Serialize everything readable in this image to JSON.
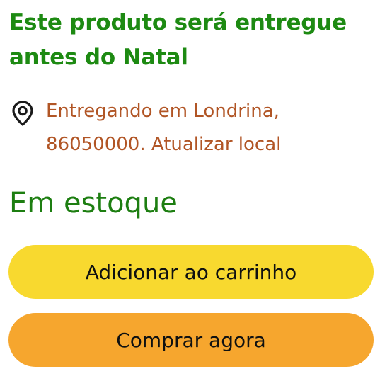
{
  "delivery": {
    "headline": "Este produto será entregue antes do Natal"
  },
  "location": {
    "icon": "location-pin-icon",
    "text": "Entregando em Londrina, 86050000. Atualizar local",
    "color": "#b15525"
  },
  "stock": {
    "status": "Em estoque",
    "color": "#1d7e11"
  },
  "actions": {
    "add_to_cart_label": "Adicionar ao carrinho",
    "add_to_cart_color": "#f8d92f",
    "buy_now_label": "Comprar agora",
    "buy_now_color": "#f6a62e"
  }
}
